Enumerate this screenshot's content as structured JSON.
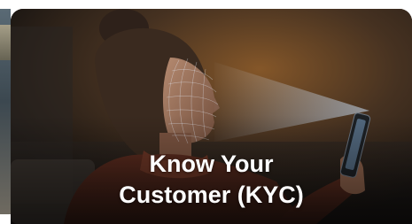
{
  "card": {
    "title_line1": "Know Your",
    "title_line2": "Customer (KYC)"
  },
  "colors": {
    "title_text": "#ffffff",
    "background_dark": "#1a1715",
    "scan_beam": "#cfe6ff"
  },
  "image": {
    "icon": "face-scan-photo"
  }
}
